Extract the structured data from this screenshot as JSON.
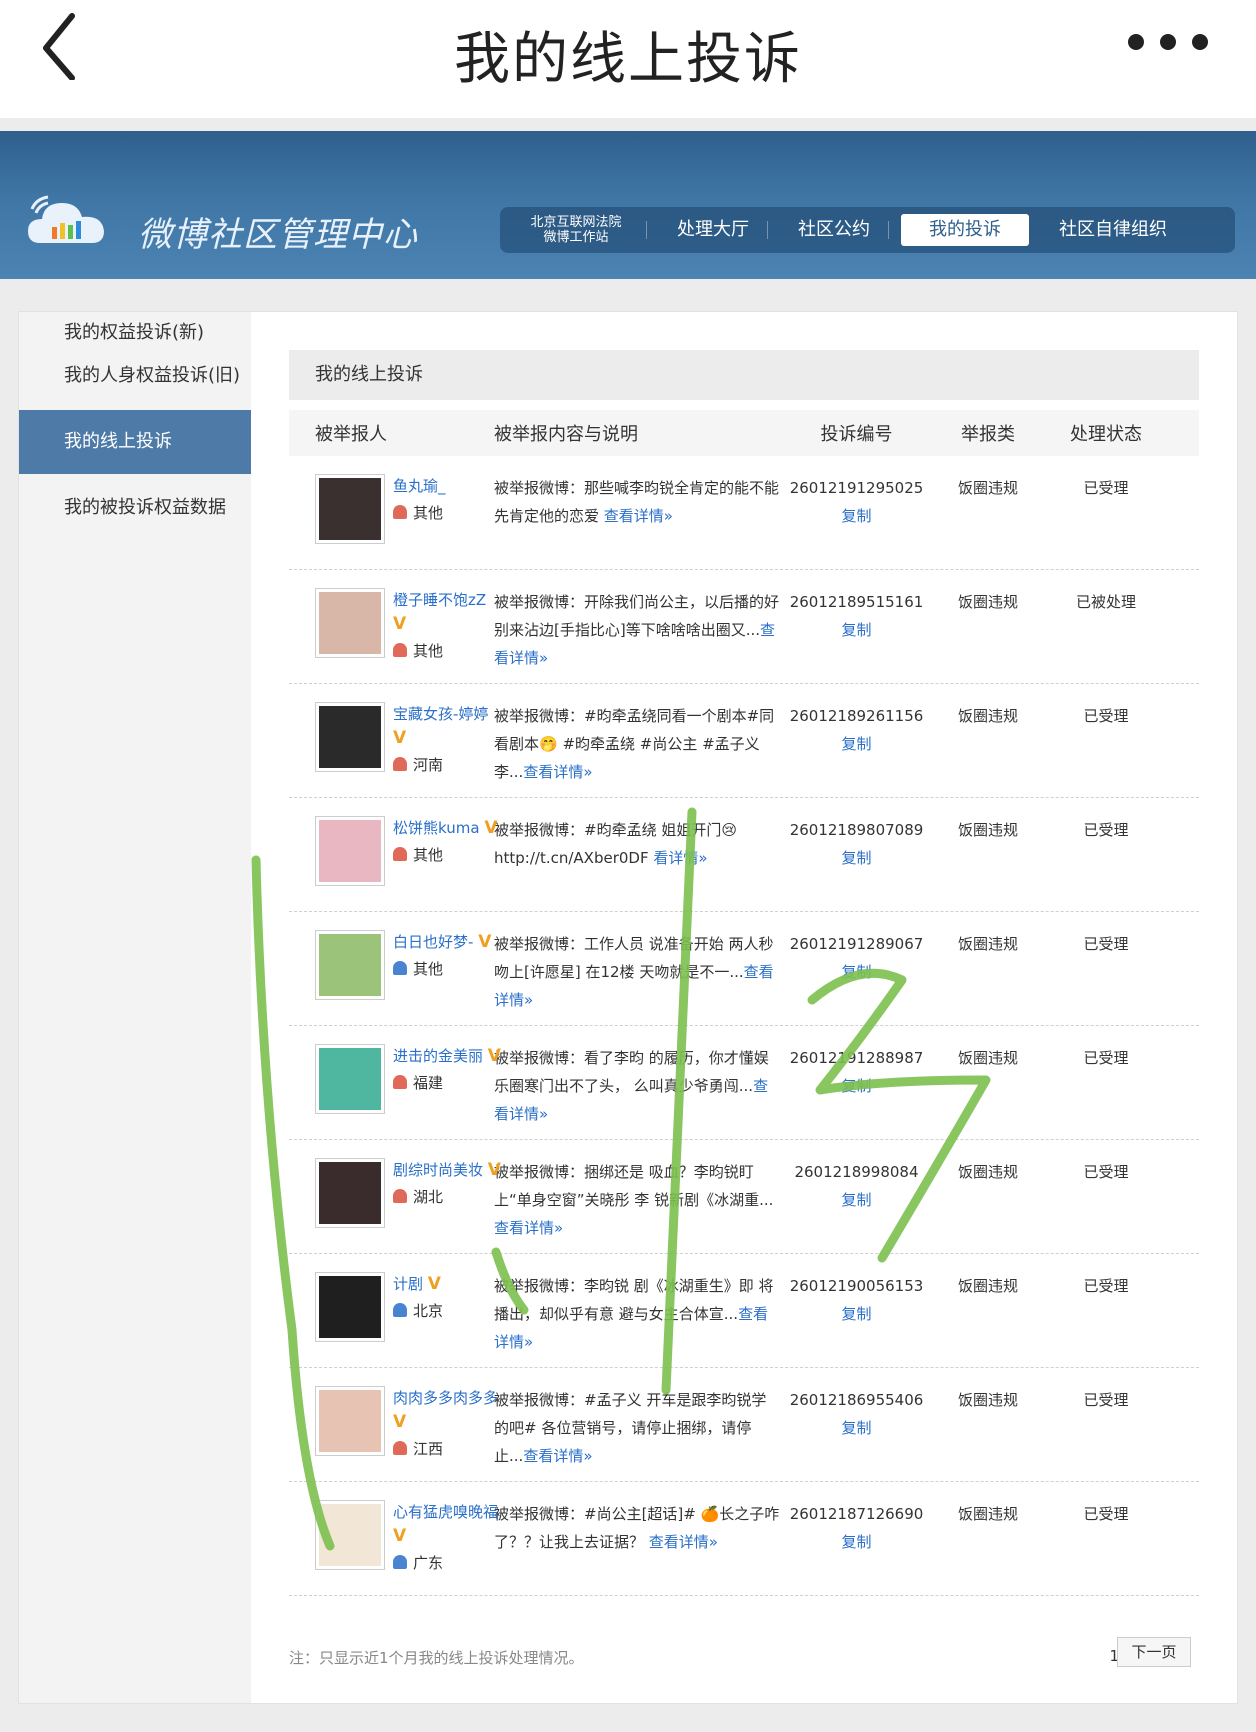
{
  "appbar": {
    "title": "我的线上投诉"
  },
  "header": {
    "brand": "微博社区管理中心",
    "court": "北京互联网法院\n微博工作站",
    "nav": [
      "处理大厅",
      "社区公约",
      "我的投诉",
      "社区自律组织"
    ]
  },
  "sidebar": [
    "我的权益投诉(新)",
    "我的人身权益投诉(旧)",
    "我的线上投诉",
    "我的被投诉权益数据"
  ],
  "panel_title": "我的线上投诉",
  "columns": [
    "被举报人",
    "被举报内容与说明",
    "投诉编号",
    "举报类",
    "处理状态"
  ],
  "copy_label": "复制",
  "rows": [
    {
      "name": "鱼丸瑜_",
      "verified": false,
      "location": "其他",
      "content": "被举报微博：那些喊李昀锐全肯定的能不能先肯定他的恋爱 ",
      "link": "查看详情»",
      "id": "26012191295025",
      "type": "饭圈违规",
      "status": "已受理",
      "avatar": "#3a3030"
    },
    {
      "name": "橙子睡不饱zZ",
      "verified": true,
      "location": "其他",
      "content": "被举报微博：开除我们尚公主，以后播的好别来沾边[手指比心]等下啥啥啥出圈又...",
      "link": "查看详情»",
      "id": "26012189515161",
      "type": "饭圈违规",
      "status": "已被处理",
      "avatar": "#d8b7a8"
    },
    {
      "name": "宝藏女孩-婷婷",
      "verified": true,
      "location": "河南",
      "content": "被举报微博：#昀牵孟绕同看一个剧本#同看剧本🤭 #昀牵孟绕 #尚公主 #孟子义李...",
      "link": "查看详情»",
      "id": "26012189261156",
      "type": "饭圈违规",
      "status": "已受理",
      "avatar": "#2a2a2a"
    },
    {
      "name": "松饼熊kuma",
      "verified": true,
      "location": "其他",
      "content": "被举报微博：#昀牵孟绕 姐姐开门😢 http://t.cn/AXber0DF ",
      "link": "看详情»",
      "id": "26012189807089",
      "type": "饭圈违规",
      "status": "已受理",
      "avatar": "#e9b7c2"
    },
    {
      "name": "白日也好梦-",
      "verified": true,
      "location": "其他",
      "content": "被举报微博：工作人员 说准备开始 两人秒吻上[许愿星] 在12楼 天吻就是不一...",
      "link": "查看详情»",
      "id": "26012191289067",
      "type": "饭圈违规",
      "status": "已受理",
      "avatar": "#9bc47a"
    },
    {
      "name": "进击的金美丽",
      "verified": true,
      "location": "福建",
      "content": "被举报微博：看了李昀 的履历，你才懂娱乐圈寒门出不了头， 么叫真少爷勇闯...",
      "link": "查看详情»",
      "id": "26012191288987",
      "type": "饭圈违规",
      "status": "已受理",
      "avatar": "#4fb7a0"
    },
    {
      "name": "剧综时尚美妆",
      "verified": true,
      "location": "湖北",
      "content": "被举报微博：捆绑还是 吸血？李昀锐盯上“单身空窗”关晓彤 李 锐新剧《冰湖重...",
      "link": "查看详情»",
      "id": "2601218998084",
      "type": "饭圈违规",
      "status": "已受理",
      "avatar": "#3a2c2c"
    },
    {
      "name": "计剧",
      "verified": true,
      "location": "北京",
      "content": "被举报微博：李昀锐 剧《冰湖重生》即 将播出，却似乎有意 避与女主合体宣...",
      "link": "查看详情»",
      "id": "26012190056153",
      "type": "饭圈违规",
      "status": "已受理",
      "avatar": "#1f1f1f"
    },
    {
      "name": "肉肉多多肉多多",
      "verified": true,
      "location": "江西",
      "content": "被举报微博：#孟子义 开车是跟李昀锐学的吧# 各位营销号，请停止捆绑，请停止...",
      "link": "查看详情»",
      "id": "26012186955406",
      "type": "饭圈违规",
      "status": "已受理",
      "avatar": "#e6c3b3"
    },
    {
      "name": "心有猛虎嗅晚福",
      "verified": true,
      "location": "广东",
      "content": "被举报微博：#尚公主[超话]# 🍊长之子咋了？？让我上去证据？ ",
      "link": "查看详情»",
      "id": "26012187126690",
      "type": "饭圈违规",
      "status": "已受理",
      "avatar": "#f2e6d6"
    }
  ],
  "footer": {
    "note": "注：只显示近1个月我的线上投诉处理情况。",
    "page": "1",
    "next": "下一页"
  }
}
